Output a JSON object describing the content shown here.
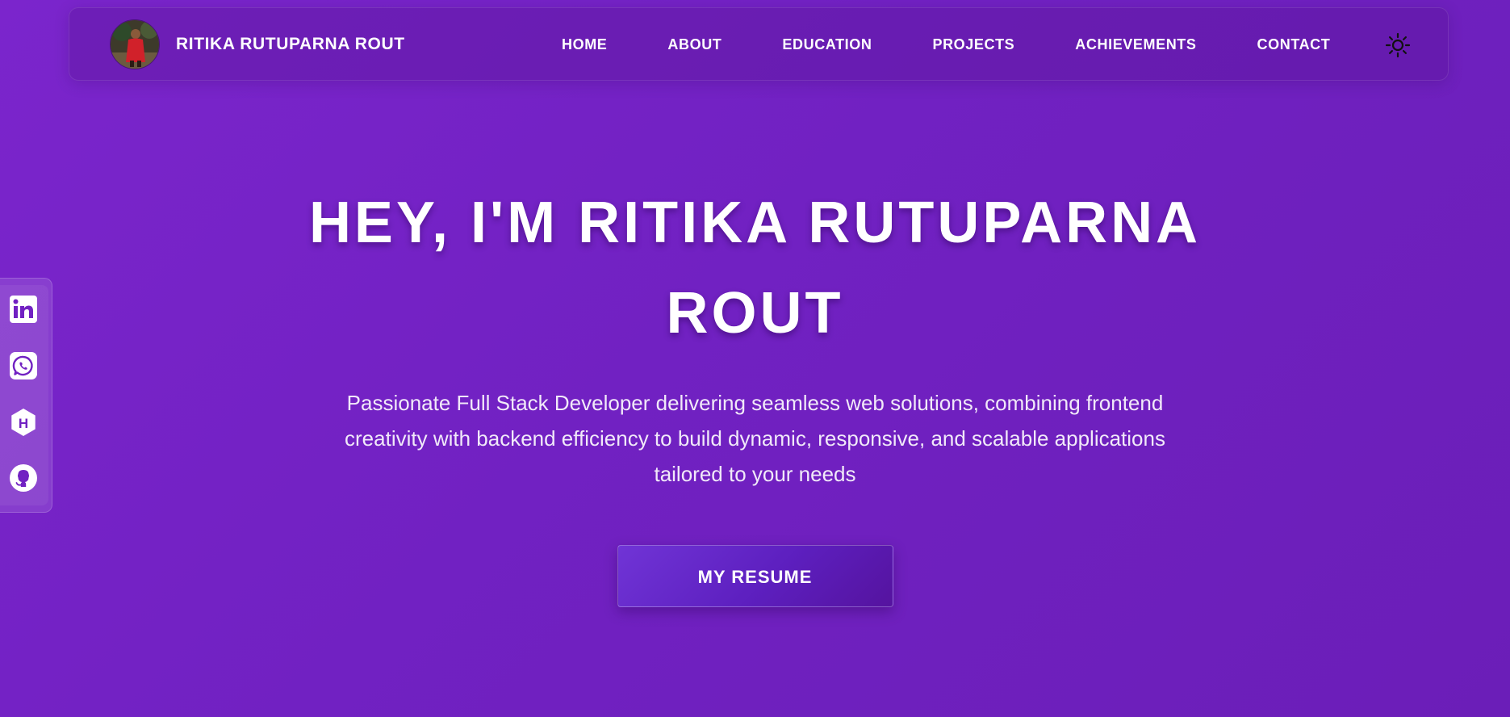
{
  "brand": {
    "name": "RITIKA RUTUPARNA ROUT",
    "avatar_icon": "profile-photo"
  },
  "nav": {
    "links": [
      {
        "label": "HOME"
      },
      {
        "label": "ABOUT"
      },
      {
        "label": "EDUCATION"
      },
      {
        "label": "PROJECTS"
      },
      {
        "label": "ACHIEVEMENTS"
      },
      {
        "label": "CONTACT"
      }
    ],
    "theme_toggle_icon": "sun-icon"
  },
  "social": {
    "icons": [
      "linkedin-icon",
      "whatsapp-icon",
      "hashnode-icon",
      "github-icon"
    ]
  },
  "hero": {
    "title": "HEY, I'M RITIKA RUTUPARNA ROUT",
    "subtitle": "Passionate Full Stack Developer delivering seamless web solutions, combining frontend creativity with backend efficiency to build dynamic, responsive, and scalable applications tailored to your needs",
    "resume_label": "MY RESUME"
  },
  "colors": {
    "background": "#7121c2",
    "navbar": "#5f1aa6",
    "button": "#6223c6",
    "text": "#ffffff"
  }
}
